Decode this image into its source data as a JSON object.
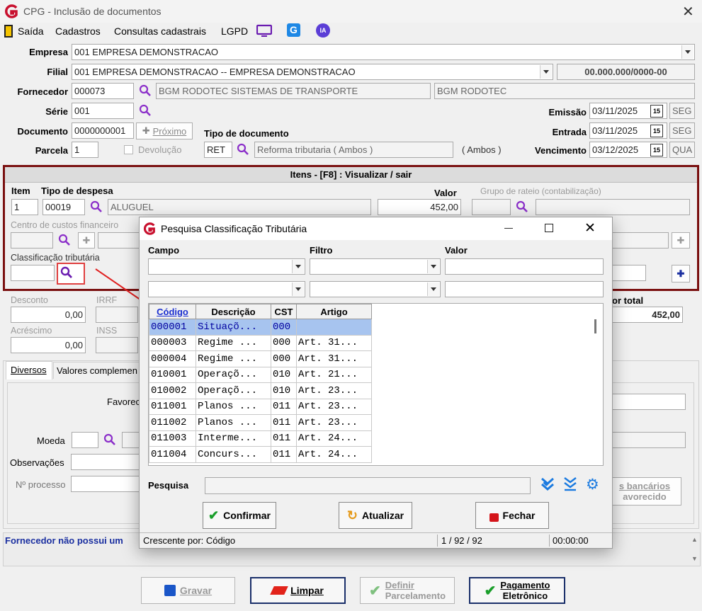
{
  "window": {
    "title": "CPG - Inclusão de documentos"
  },
  "menu": {
    "items": [
      "Saída",
      "Cadastros",
      "Consultas cadastrais",
      "LGPD"
    ],
    "badge_ia": "IA"
  },
  "header": {
    "empresa_label": "Empresa",
    "empresa_value": "001 EMPRESA DEMONSTRACAO",
    "filial_label": "Filial",
    "filial_value": "001 EMPRESA DEMONSTRACAO -- EMPRESA DEMONSTRACAO",
    "cnpj": "00.000.000/0000-00",
    "fornecedor_label": "Fornecedor",
    "fornecedor_code": "000073",
    "fornecedor_name": "BGM RODOTEC SISTEMAS DE TRANSPORTE",
    "fornecedor_fantasia": "BGM RODOTEC",
    "serie_label": "Série",
    "serie_value": "001",
    "documento_label": "Documento",
    "documento_value": "0000000001",
    "proximo_label": "Próximo",
    "tipo_doc_label": "Tipo de documento",
    "parcela_label": "Parcela",
    "parcela_value": "1",
    "devolucao_label": "Devolução",
    "tipo_doc_code": "RET",
    "tipo_doc_desc": "Reforma tributaria ( Ambos )",
    "tipo_doc_extra": "( Ambos )",
    "emissao_label": "Emissão",
    "emissao_date": "03/11/2025",
    "emissao_day": "SEG",
    "entrada_label": "Entrada",
    "entrada_date": "03/11/2025",
    "entrada_day": "SEG",
    "vencimento_label": "Vencimento",
    "vencimento_date": "03/12/2025",
    "vencimento_day": "QUA",
    "cal_glyph": "15"
  },
  "itens": {
    "title": "Itens  - [F8] : Visualizar / sair",
    "item_label": "Item",
    "tipo_despesa_label": "Tipo de despesa",
    "valor_label": "Valor",
    "grupo_rateio_label": "Grupo de rateio (contabilização)",
    "item_value": "1",
    "tipo_code": "00019",
    "tipo_desc": "ALUGUEL",
    "valor_value": "452,00",
    "centro_custos_label": "Centro de custos financeiro",
    "class_trib_label": "Classificação tributária"
  },
  "totals": {
    "desconto_label": "Desconto",
    "desconto_value": "0,00",
    "irrf_label": "IRRF",
    "acrescimo_label": "Acréscimo",
    "acrescimo_value": "0,00",
    "inss_label": "INSS",
    "valor_total_label": "or total",
    "valor_total_value": "452,00"
  },
  "tabs": {
    "diversos": "Diversos",
    "valores": "Valores complemen"
  },
  "diversos": {
    "favorecido_label": "Favorec",
    "moeda_label": "Moeda",
    "observacoes_label": "Observações",
    "processo_label": "Nº processo",
    "dados_bancarios": "s bancários",
    "dados_bancarios2": "avorecido"
  },
  "status": {
    "message": "Fornecedor não possui um"
  },
  "footer": {
    "gravar": "Gravar",
    "limpar": "Limpar",
    "definir1": "Definir",
    "definir2": "Parcelamento",
    "pagamento1": "Pagamento",
    "pagamento2": "Eletrônico"
  },
  "dialog": {
    "title": "Pesquisa Classificação Tributária",
    "campo_label": "Campo",
    "filtro_label": "Filtro",
    "valor_label": "Valor",
    "columns": [
      "Código",
      "Descrição",
      "CST",
      "Artigo"
    ],
    "rows": [
      [
        "000001",
        "Situaçõ...",
        "000",
        ""
      ],
      [
        "000003",
        "Regime ...",
        "000",
        "Art. 31..."
      ],
      [
        "000004",
        "Regime ...",
        "000",
        "Art. 31..."
      ],
      [
        "010001",
        "Operaçõ...",
        "010",
        "Art. 21..."
      ],
      [
        "010002",
        "Operaçõ...",
        "010",
        "Art. 23..."
      ],
      [
        "011001",
        "Planos ...",
        "011",
        "Art. 23..."
      ],
      [
        "011002",
        "Planos ...",
        "011",
        "Art. 23..."
      ],
      [
        "011003",
        "Interme...",
        "011",
        "Art. 24..."
      ],
      [
        "011004",
        "Concurs...",
        "011",
        "Art. 24..."
      ]
    ],
    "pesquisa_label": "Pesquisa",
    "confirmar": "Confirmar",
    "atualizar": "Atualizar",
    "fechar": "Fechar",
    "status_sort": "Crescente por: Código",
    "status_count": "1 / 92 / 92",
    "status_time": "00:00:00"
  },
  "colors": {
    "accent_purple": "#8b2fc9",
    "brand_red": "#c8102e",
    "frame_red": "#7a1010",
    "selection": "#a7c4ef"
  }
}
